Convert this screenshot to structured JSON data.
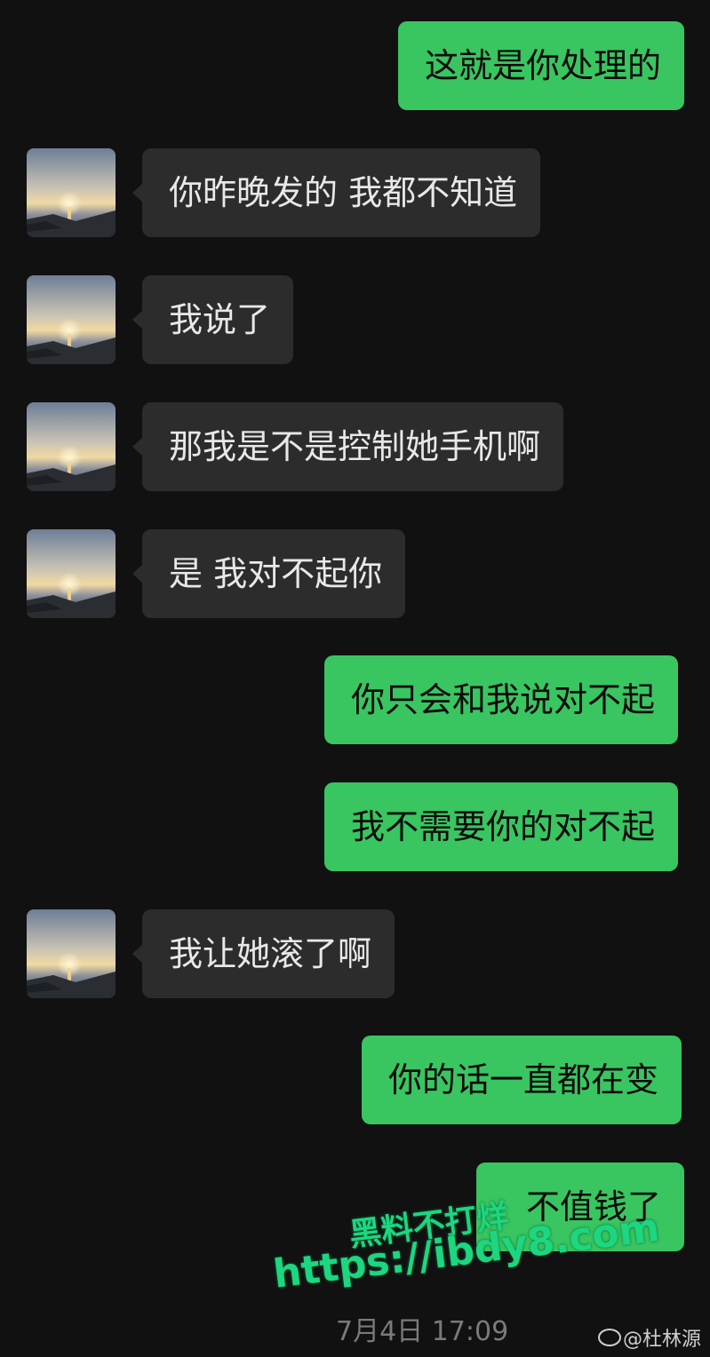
{
  "messages": [
    {
      "side": "out",
      "text": "这就是你处理的"
    },
    {
      "side": "in",
      "text": "你昨晚发的 我都不知道"
    },
    {
      "side": "in",
      "text": "我说了"
    },
    {
      "side": "in",
      "text": "那我是不是控制她手机啊"
    },
    {
      "side": "in",
      "text": "是 我对不起你"
    },
    {
      "side": "out",
      "text": "你只会和我说对不起"
    },
    {
      "side": "out",
      "text": "我不需要你的对不起"
    },
    {
      "side": "in",
      "text": "我让她滚了啊"
    },
    {
      "side": "out",
      "text": "你的话一直都在变"
    },
    {
      "side": "out",
      "text": "不值钱了"
    }
  ],
  "timestamp": "7月4日 17:09",
  "watermark": {
    "line1": "黑料不打烊",
    "line2": "https://ibdy8.com"
  },
  "weibo_mark": {
    "text": "@杜林源",
    "icon": "weibo-logo-icon"
  },
  "avatar_icon": "sunset-avatar-icon",
  "colors": {
    "background": "#111111",
    "outgoing_bubble": "#39c560",
    "incoming_bubble": "#2c2c2c",
    "watermark": "#1cd680"
  }
}
